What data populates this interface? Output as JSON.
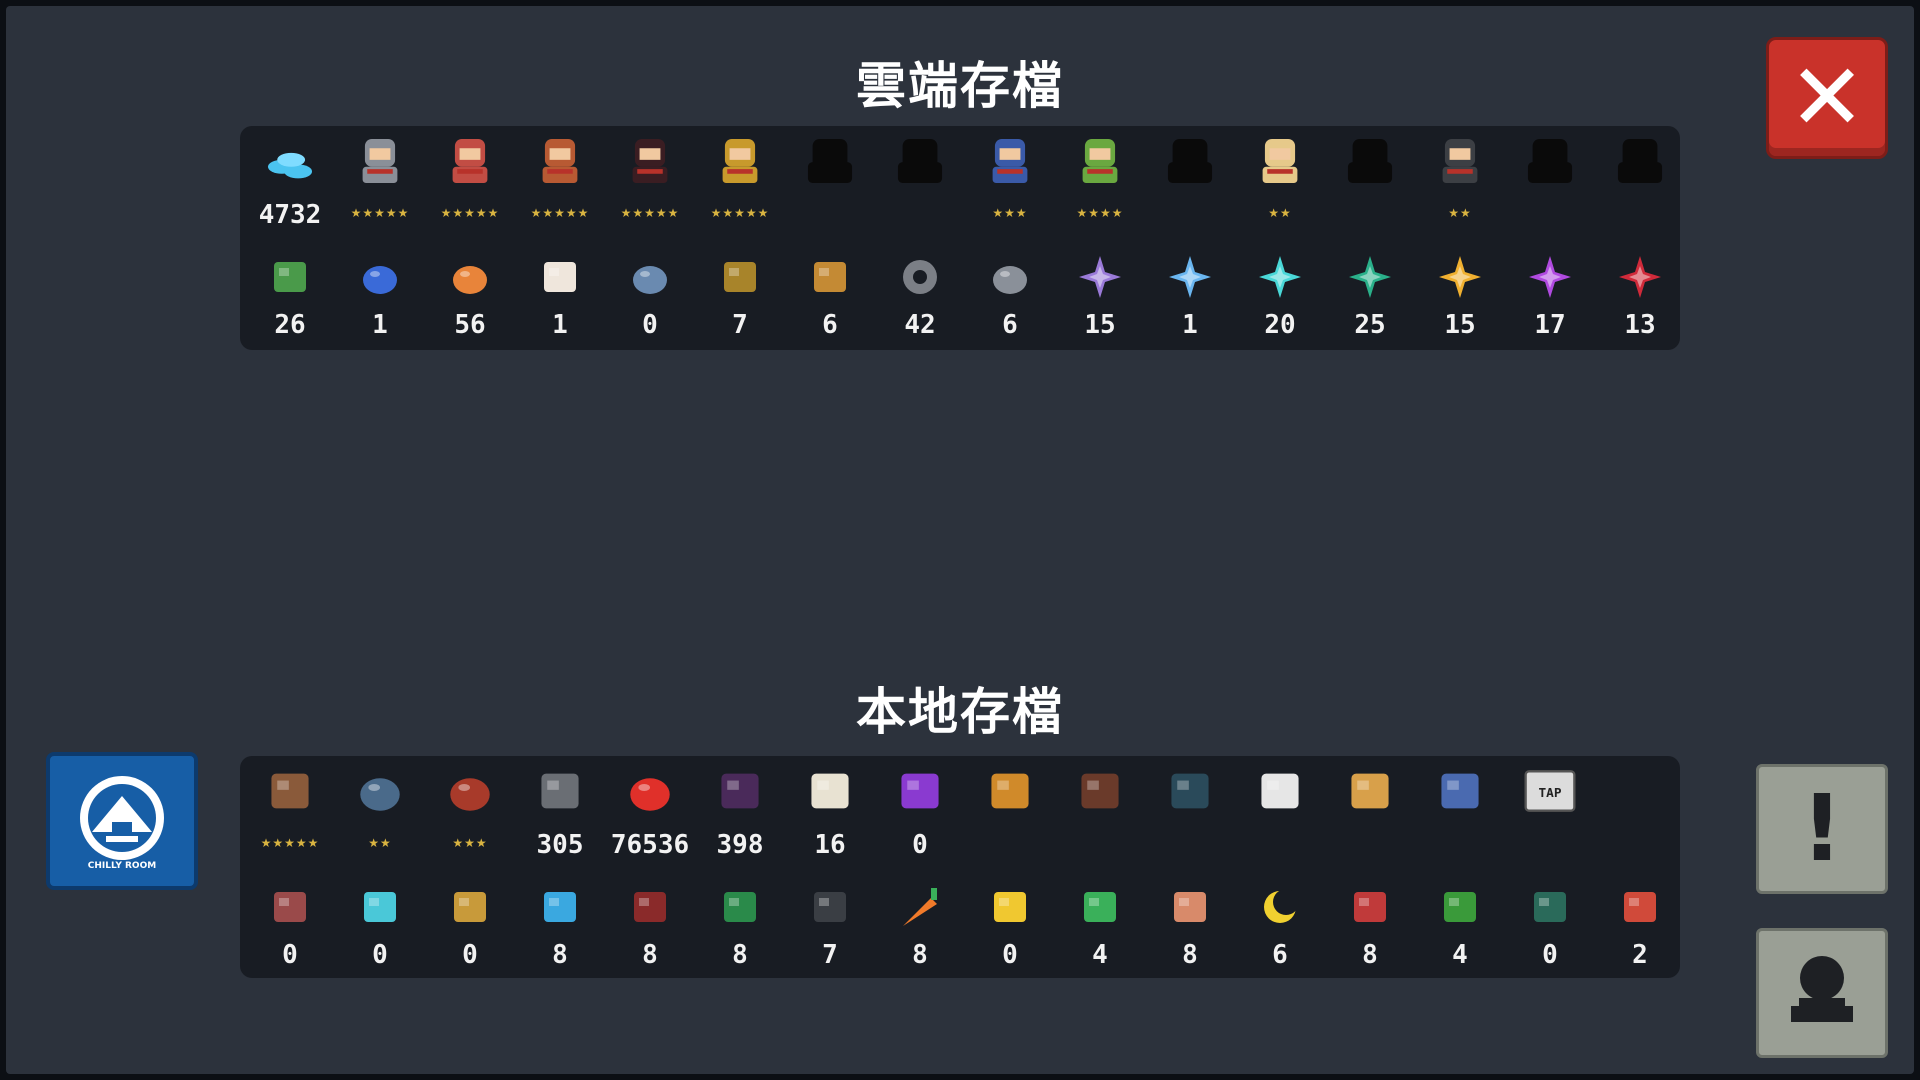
{
  "cloud_save": {
    "title": "雲端存檔",
    "characters": [
      {
        "name": "gem-stack-icon",
        "value": "4732",
        "stars": "",
        "color": "#4bc4f0"
      },
      {
        "name": "knight-portrait-icon",
        "value": "",
        "stars": "★★★★★",
        "color": "#8a8f98"
      },
      {
        "name": "rogue-portrait-icon",
        "value": "",
        "stars": "★★★★★",
        "color": "#c24d44"
      },
      {
        "name": "witch-portrait-icon",
        "value": "",
        "stars": "★★★★★",
        "color": "#b85a33"
      },
      {
        "name": "assassin-portrait-icon",
        "value": "",
        "stars": "★★★★★",
        "color": "#3a1d22"
      },
      {
        "name": "robot-portrait-icon",
        "value": "",
        "stars": "★★★★★",
        "color": "#c89a2c"
      },
      {
        "name": "locked-character-silhouette-icon",
        "value": "",
        "stars": "",
        "color": "#0a0a0a"
      },
      {
        "name": "locked-character-silhouette-icon",
        "value": "",
        "stars": "",
        "color": "#0a0a0a"
      },
      {
        "name": "paladin-portrait-icon",
        "value": "",
        "stars": "★★★",
        "color": "#3a5aa8"
      },
      {
        "name": "elf-portrait-icon",
        "value": "",
        "stars": "★★★★",
        "color": "#6aa840"
      },
      {
        "name": "locked-character-silhouette-icon",
        "value": "",
        "stars": "",
        "color": "#0a0a0a"
      },
      {
        "name": "priest-portrait-icon",
        "value": "",
        "stars": "★★",
        "color": "#e6c98a"
      },
      {
        "name": "locked-character-silhouette-icon",
        "value": "",
        "stars": "",
        "color": "#0a0a0a"
      },
      {
        "name": "officer-portrait-icon",
        "value": "",
        "stars": "★★",
        "color": "#3c3f44"
      },
      {
        "name": "locked-character-silhouette-icon",
        "value": "",
        "stars": "",
        "color": "#0a0a0a"
      },
      {
        "name": "locked-character-silhouette-icon",
        "value": "",
        "stars": "",
        "color": "#0a0a0a"
      }
    ],
    "materials": [
      {
        "name": "battery-icon",
        "value": "26",
        "color": "#4a9a4a"
      },
      {
        "name": "potion-bundle-icon",
        "value": "1",
        "color": "#3a6ad8"
      },
      {
        "name": "orange-ore-icon",
        "value": "56",
        "color": "#e8843a"
      },
      {
        "name": "seed-bag-icon",
        "value": "1",
        "color": "#efe6dc"
      },
      {
        "name": "feather-coin-icon",
        "value": "0",
        "color": "#6a8ab0"
      },
      {
        "name": "horn-icon",
        "value": "7",
        "color": "#a8842a"
      },
      {
        "name": "wood-log-icon",
        "value": "6",
        "color": "#c48a34"
      },
      {
        "name": "gear-part-icon",
        "value": "42",
        "color": "#7b7f86"
      },
      {
        "name": "iron-ore-icon",
        "value": "6",
        "color": "#8a9099"
      },
      {
        "name": "purple-crystal-icon",
        "value": "15",
        "color": "#9a7ad8"
      },
      {
        "name": "blue-crystal-icon",
        "value": "1",
        "color": "#6ab6f0"
      },
      {
        "name": "cyan-crystal-icon",
        "value": "20",
        "color": "#4ad8d8"
      },
      {
        "name": "green-crystal-icon",
        "value": "25",
        "color": "#2ab08a"
      },
      {
        "name": "gold-crystal-icon",
        "value": "15",
        "color": "#f0b030"
      },
      {
        "name": "violet-crystal-icon",
        "value": "17",
        "color": "#b04ae0"
      },
      {
        "name": "red-crystal-icon",
        "value": "13",
        "color": "#d02a3a"
      }
    ]
  },
  "local_save": {
    "title": "本地存檔",
    "row1": [
      {
        "name": "book-stack-icon",
        "value": "",
        "stars": "★★★★★",
        "color": "#8a5a3a"
      },
      {
        "name": "round-pot-icon",
        "value": "",
        "stars": "★★",
        "color": "#4a6a8a"
      },
      {
        "name": "plant-pot-icon",
        "value": "",
        "stars": "★★★",
        "color": "#a83a2a"
      },
      {
        "name": "pistol-icon",
        "value": "305",
        "stars": "",
        "color": "#6a6e74"
      },
      {
        "name": "red-slime-icon",
        "value": "76536",
        "stars": "",
        "color": "#e0302a"
      },
      {
        "name": "horned-beast-icon",
        "value": "398",
        "stars": "",
        "color": "#4a2a5a"
      },
      {
        "name": "card-icon",
        "value": "16",
        "stars": "",
        "color": "#e8e2d2"
      },
      {
        "name": "demon-mask-icon",
        "value": "0",
        "stars": "",
        "color": "#8a3ad0"
      },
      {
        "name": "dragon-outline-icon",
        "value": "",
        "stars": "",
        "color": "#d08a2a"
      },
      {
        "name": "small-gun-icon",
        "value": "",
        "stars": "",
        "color": "#6a3a2a"
      },
      {
        "name": "black-cat-icon",
        "value": "",
        "stars": "",
        "color": "#2a4a5a"
      },
      {
        "name": "panda-dog-icon",
        "value": "",
        "stars": "",
        "color": "#e6e6e6"
      },
      {
        "name": "shiba-dog-icon",
        "value": "",
        "stars": "",
        "color": "#d8a04a"
      },
      {
        "name": "robot-pet-icon",
        "value": "",
        "stars": "",
        "color": "#4a6ab0"
      },
      {
        "name": "tap-key-icon",
        "value": "",
        "stars": "",
        "color": "#dcdcdc",
        "label": "TAP"
      }
    ],
    "row2": [
      {
        "name": "forge-icon",
        "value": "0",
        "color": "#9a4a4a"
      },
      {
        "name": "water-tank-icon",
        "value": "0",
        "color": "#4ac8d8"
      },
      {
        "name": "machine-icon",
        "value": "0",
        "color": "#c89a3a"
      },
      {
        "name": "blue-fish-icon",
        "value": "8",
        "color": "#3aa8e0"
      },
      {
        "name": "circuit-icon",
        "value": "8",
        "color": "#8a2a2a"
      },
      {
        "name": "turret-icon",
        "value": "8",
        "color": "#2a8a4a"
      },
      {
        "name": "stone-tablet-icon",
        "value": "7",
        "color": "#3a3e44"
      },
      {
        "name": "carrot-icon",
        "value": "8",
        "color": "#f07a2a"
      },
      {
        "name": "yellow-box-icon",
        "value": "0",
        "color": "#f0c830"
      },
      {
        "name": "herb-icon",
        "value": "4",
        "color": "#3ab05a"
      },
      {
        "name": "toast-icon",
        "value": "8",
        "color": "#d88a6a"
      },
      {
        "name": "moon-icon",
        "value": "6",
        "color": "#f0d030"
      },
      {
        "name": "red-robot-icon",
        "value": "8",
        "color": "#c03a3a"
      },
      {
        "name": "green-block-icon",
        "value": "4",
        "color": "#3a9a3a"
      },
      {
        "name": "shield-crest-icon",
        "value": "0",
        "color": "#2a6a5a"
      },
      {
        "name": "flag-icon",
        "value": "2",
        "color": "#d04a3a"
      }
    ]
  },
  "buttons": {
    "close_glyph": "✕",
    "alert_glyph": "!",
    "logo_text": "CHILLY ROOM"
  }
}
